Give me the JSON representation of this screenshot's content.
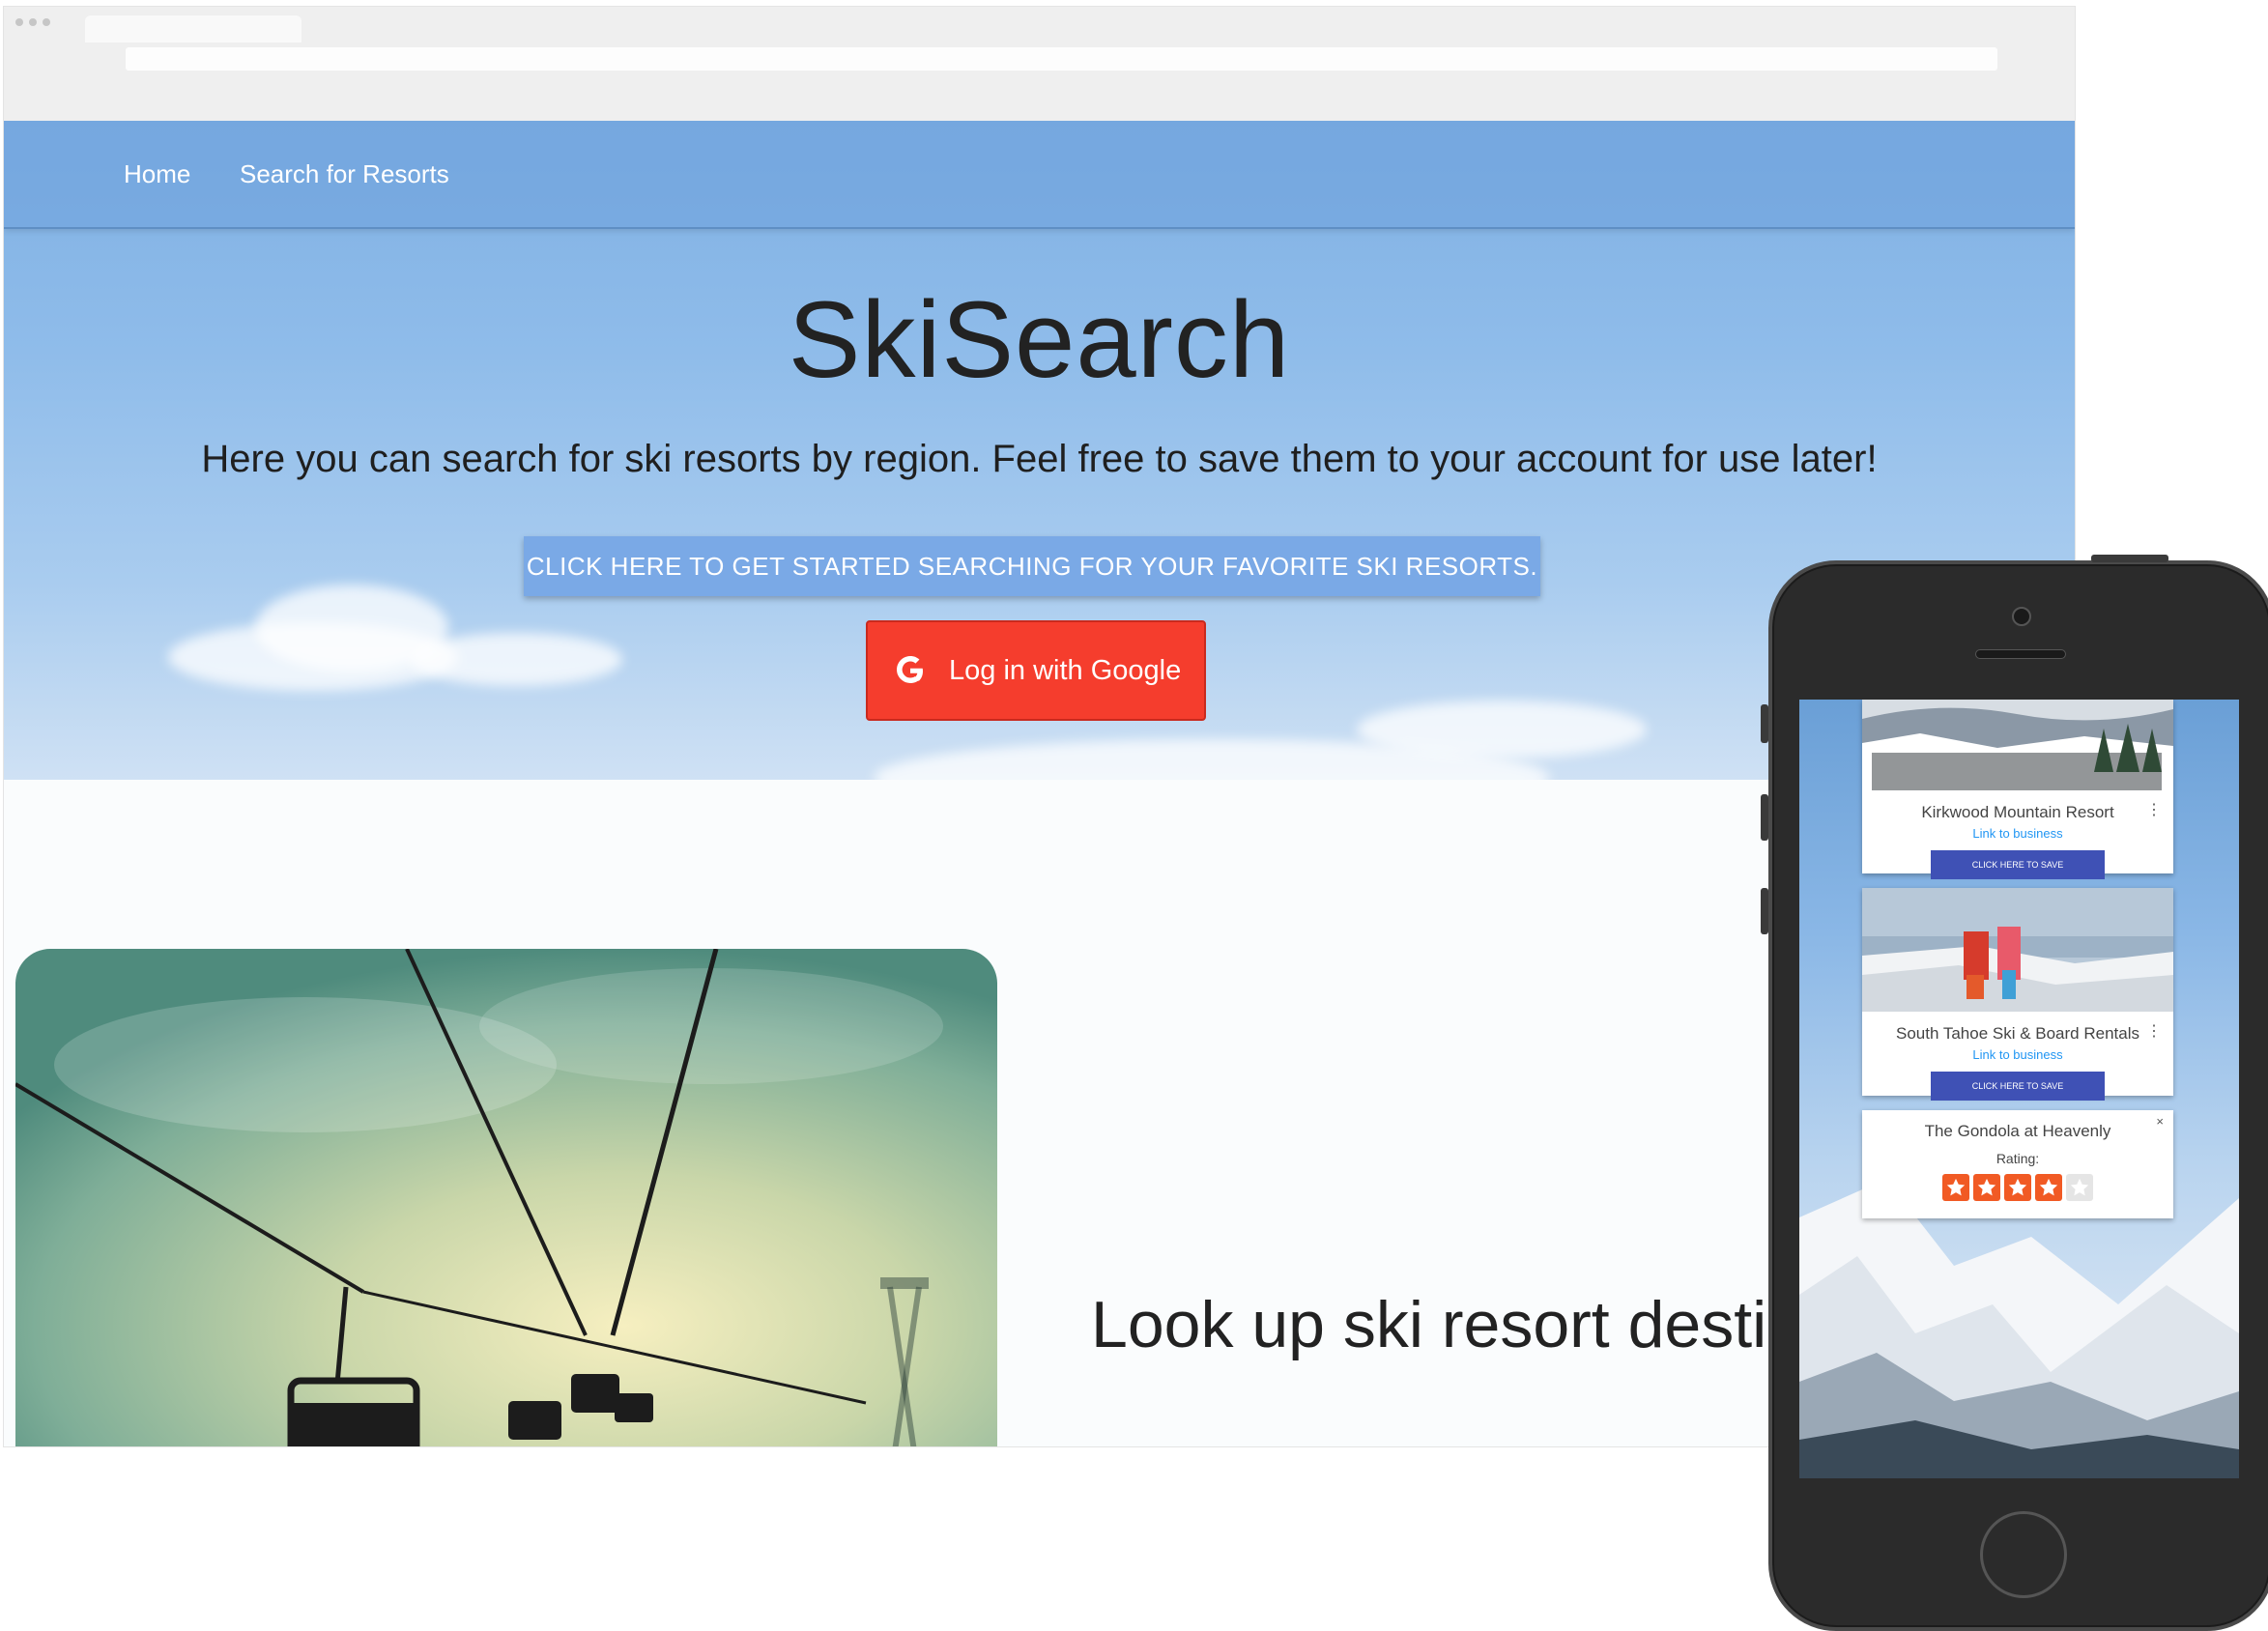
{
  "desktop": {
    "nav": {
      "home": "Home",
      "search": "Search for Resorts"
    },
    "hero": {
      "title": "SkiSearch",
      "subtitle": "Here you can search for ski resorts by region. Feel free to save them to your account for use later!",
      "cta": "CLICK HERE TO GET STARTED SEARCHING FOR YOUR FAVORITE SKI RESORTS.",
      "google_login": "Log in with Google"
    },
    "section": {
      "heading": "Look up ski resort desti"
    }
  },
  "phone": {
    "cards": [
      {
        "name": "Kirkwood Mountain Resort",
        "link": "Link to business",
        "save": "CLICK HERE TO SAVE"
      },
      {
        "name": "South Tahoe Ski & Board Rentals",
        "link": "Link to business",
        "save": "CLICK HERE TO SAVE"
      }
    ],
    "rating_card": {
      "name": "The Gondola at Heavenly",
      "rating_label": "Rating:",
      "rating": 4,
      "max_rating": 5,
      "close": "×"
    }
  },
  "colors": {
    "nav_blue": "#7aa9e6",
    "google_red": "#f53d2d",
    "save_button": "#3f51b5",
    "link_blue": "#2196f3",
    "star_orange": "#f15a24"
  }
}
